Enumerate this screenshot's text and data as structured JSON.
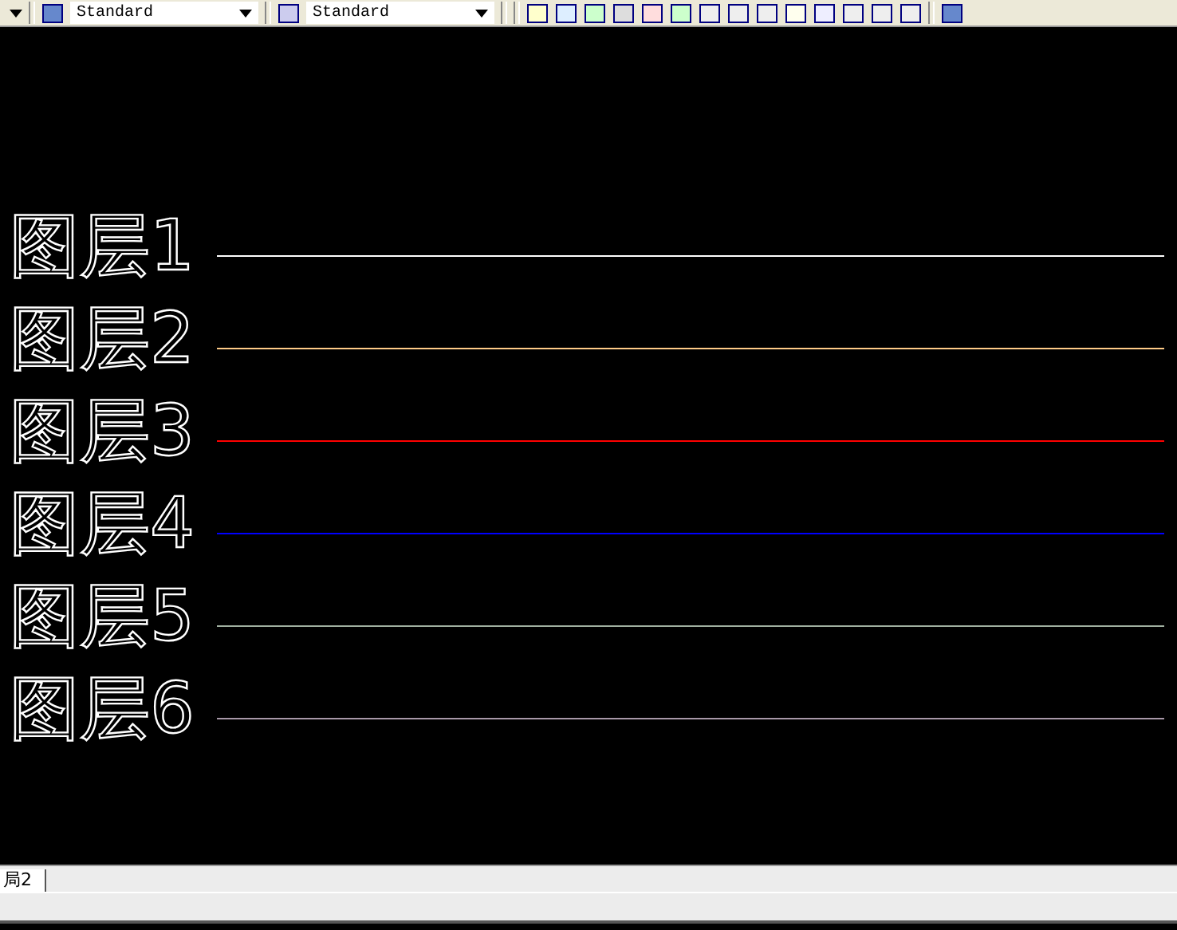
{
  "toolbar": {
    "combos": [
      {
        "value": "Standard"
      },
      {
        "value": "Standard"
      }
    ]
  },
  "layers": [
    {
      "label": "图层1",
      "color": "#ffffff"
    },
    {
      "label": "图层2",
      "color": "#ffcc88"
    },
    {
      "label": "图层3",
      "color": "#ff0000"
    },
    {
      "label": "图层4",
      "color": "#0000ff"
    },
    {
      "label": "图层5",
      "color": "#a0b0a0"
    },
    {
      "label": "图层6",
      "color": "#a898a8"
    }
  ],
  "layout_tabs": [
    {
      "label": "局2",
      "selected": true
    }
  ]
}
